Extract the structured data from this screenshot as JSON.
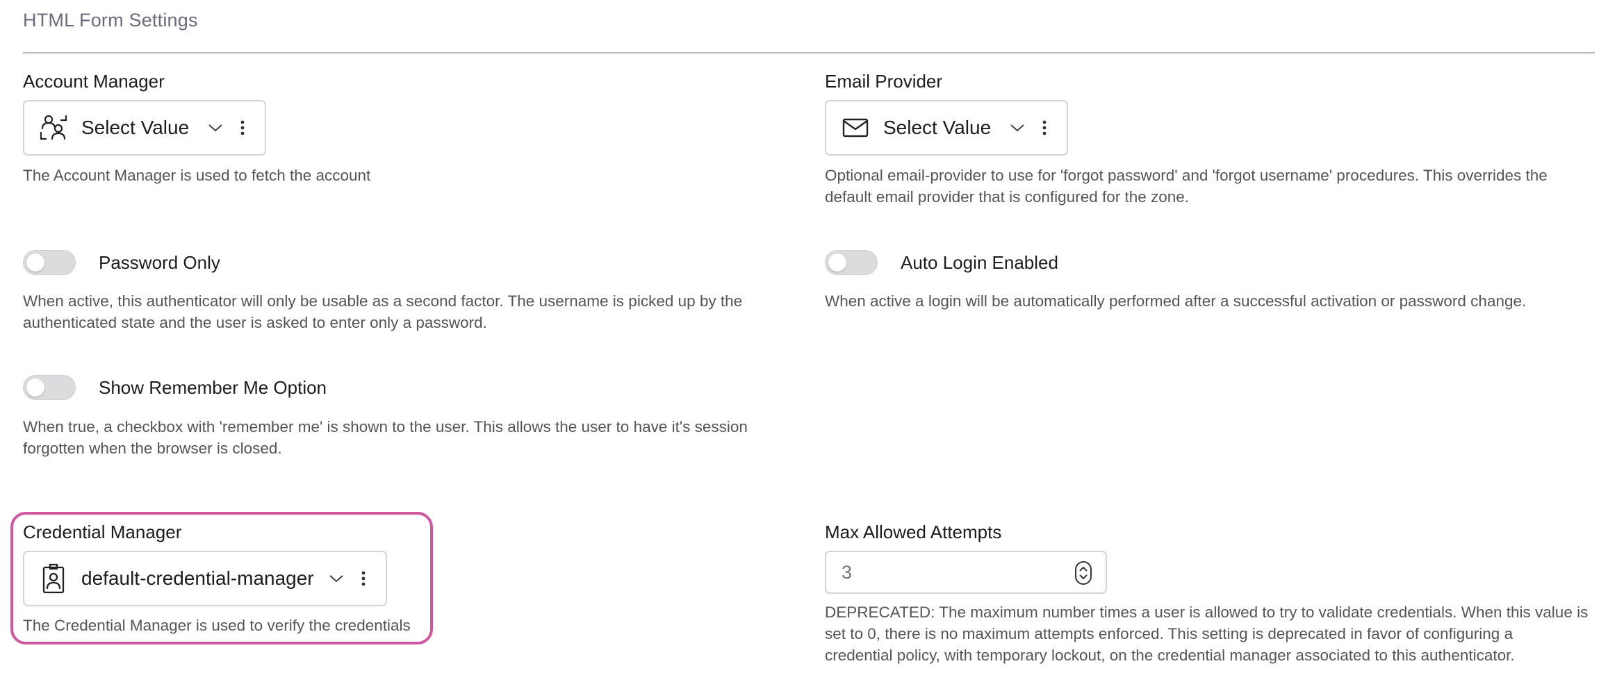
{
  "section": {
    "title": "HTML Form Settings"
  },
  "account_manager": {
    "label": "Account Manager",
    "value": "Select Value",
    "icon": "account-manager-icon",
    "help": "The Account Manager is used to fetch the account"
  },
  "email_provider": {
    "label": "Email Provider",
    "value": "Select Value",
    "icon": "envelope-icon",
    "help_line1": "Optional email-provider to use for 'forgot password' and 'forgot username' procedures. This overrides the",
    "help_line2": "default email provider that is configured for the zone."
  },
  "password_only": {
    "label": "Password Only",
    "enabled": false,
    "help_line1": "When active, this authenticator will only be usable as a second factor. The username is picked up by the",
    "help_line2": "authenticated state and the user is asked to enter only a password."
  },
  "auto_login": {
    "label": "Auto Login Enabled",
    "enabled": false,
    "help": "When active a login will be automatically performed after a successful activation or password change."
  },
  "remember_me": {
    "label": "Show Remember Me Option",
    "enabled": false,
    "help_line1": "When true, a checkbox with 'remember me' is shown to the user. This allows the user to have it's session",
    "help_line2": "forgotten when the browser is closed."
  },
  "credential_manager": {
    "label": "Credential Manager",
    "value": "default-credential-manager",
    "icon": "id-badge-icon",
    "help": "The Credential Manager is used to verify the credentials",
    "highlight_color": "#d2559f"
  },
  "max_attempts": {
    "label": "Max Allowed Attempts",
    "value": "3",
    "help_line1": "DEPRECATED: The maximum number times a user is allowed to try to validate credentials. When this value is",
    "help_line2": "set to 0, there is no maximum attempts enforced. This setting is deprecated in favor of configuring a",
    "help_line3": "credential policy, with temporary lockout, on the credential manager associated to this authenticator."
  },
  "colors": {
    "toggle_off": "#dcdcde",
    "border": "#d4d4d8",
    "helper_text": "#555555"
  }
}
